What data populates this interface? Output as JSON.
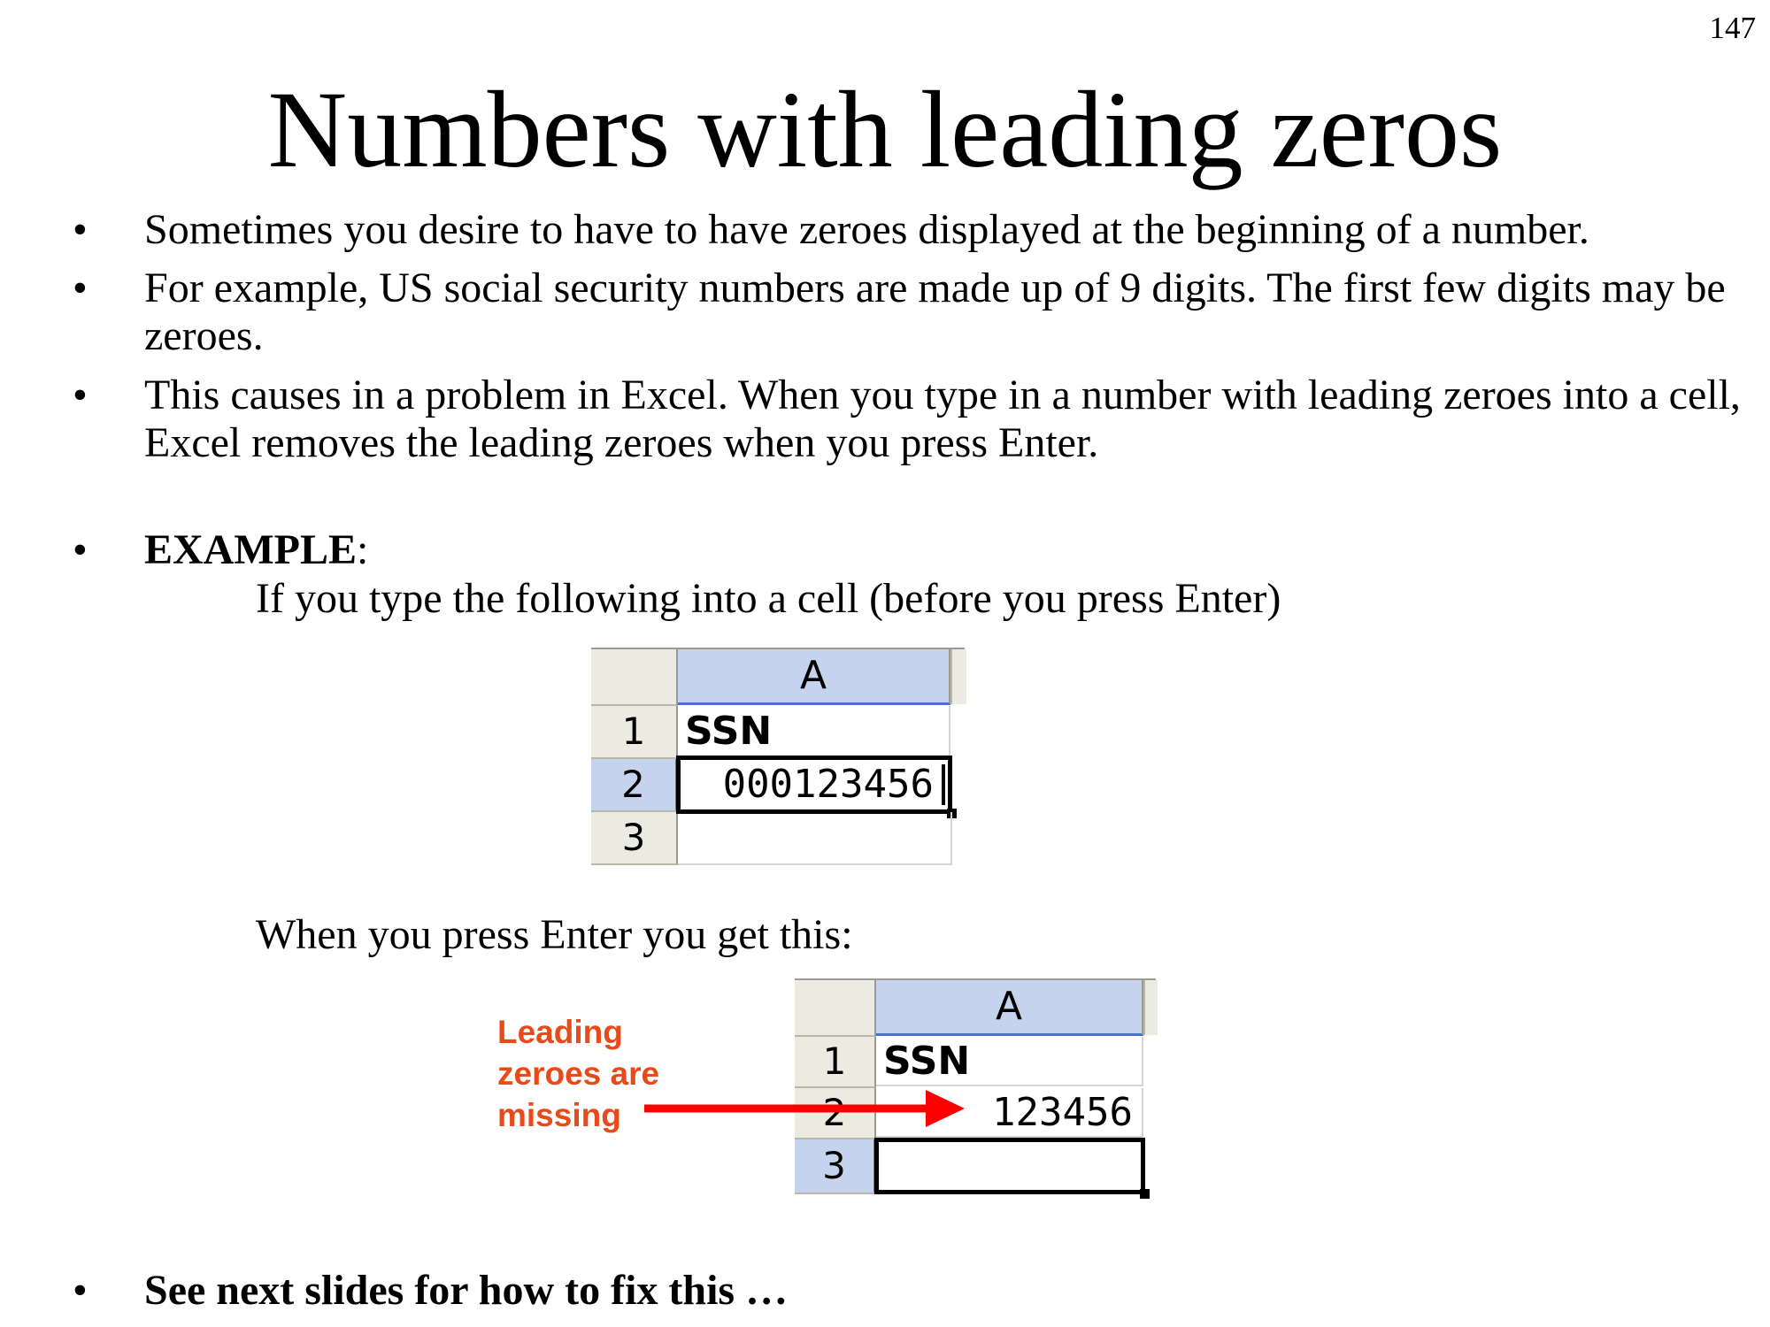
{
  "page_number": "147",
  "title": "Numbers with leading zeros",
  "bullets": [
    "Sometimes you desire to have to have zeroes displayed at the beginning of a number.",
    "For example, US social security numbers are made up of 9 digits. The first few digits may be zeroes.",
    "This causes in a problem in Excel. When you type in a number with leading zeroes into a cell, Excel removes the leading zeroes when you press Enter."
  ],
  "bullet_glyph": "•",
  "example": {
    "label": "EXAMPLE",
    "colon": ":",
    "line1": "If you type the following into a cell (before you press Enter)",
    "line2": "When you press Enter you get this:"
  },
  "sheet_before": {
    "column": "A",
    "rows": [
      "1",
      "2",
      "3"
    ],
    "cells": [
      "SSN",
      "000123456",
      ""
    ]
  },
  "sheet_after": {
    "column": "A",
    "rows": [
      "1",
      "2",
      "3"
    ],
    "cells": [
      "SSN",
      "123456",
      ""
    ]
  },
  "annotation": {
    "text_lines": [
      "Leading",
      "zeroes are",
      "missing"
    ],
    "color": "#e84a1a",
    "arrow_color": "#ff0000"
  },
  "footer": "See next slides for how to fix this …"
}
